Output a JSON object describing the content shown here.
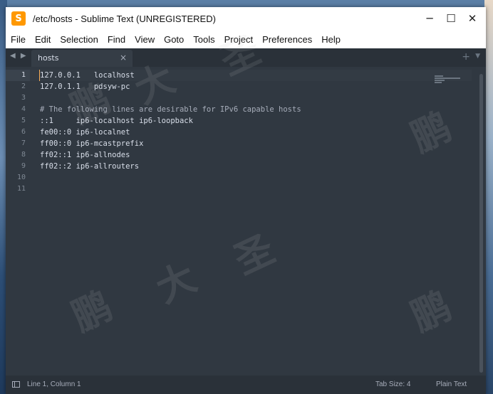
{
  "window": {
    "title": "/etc/hosts - Sublime Text (UNREGISTERED)",
    "app_icon_letter": "S",
    "minimize_glyph": "─",
    "maximize_glyph": "☐",
    "close_glyph": "✕"
  },
  "menu": [
    "File",
    "Edit",
    "Selection",
    "Find",
    "View",
    "Goto",
    "Tools",
    "Project",
    "Preferences",
    "Help"
  ],
  "tabs": {
    "nav_glyph": "◀ ▶",
    "active_label": "hosts",
    "close_glyph": "×",
    "new_tab_glyph": "+",
    "dropdown_glyph": "▼"
  },
  "editor": {
    "line_numbers": [
      "1",
      "2",
      "3",
      "4",
      "5",
      "6",
      "7",
      "8",
      "9",
      "10",
      "11"
    ],
    "lines": [
      "127.0.0.1   localhost",
      "127.0.1.1   pdsyw-pc",
      "",
      "# The following lines are desirable for IPv6 capable hosts",
      "::1     ip6-localhost ip6-loopback",
      "fe00::0 ip6-localnet",
      "ff00::0 ip6-mcastprefix",
      "ff02::1 ip6-allnodes",
      "ff02::2 ip6-allrouters",
      "",
      ""
    ],
    "active_line": 1
  },
  "watermark": {
    "chars": [
      "鹏",
      "大",
      "圣"
    ]
  },
  "status": {
    "position": "Line 1, Column 1",
    "tab_size": "Tab Size: 4",
    "syntax": "Plain Text"
  },
  "colors": {
    "editor_bg": "#303841",
    "foreground": "#d8dee9",
    "cursor": "#f9ae58",
    "app_icon": "#ff9800"
  }
}
